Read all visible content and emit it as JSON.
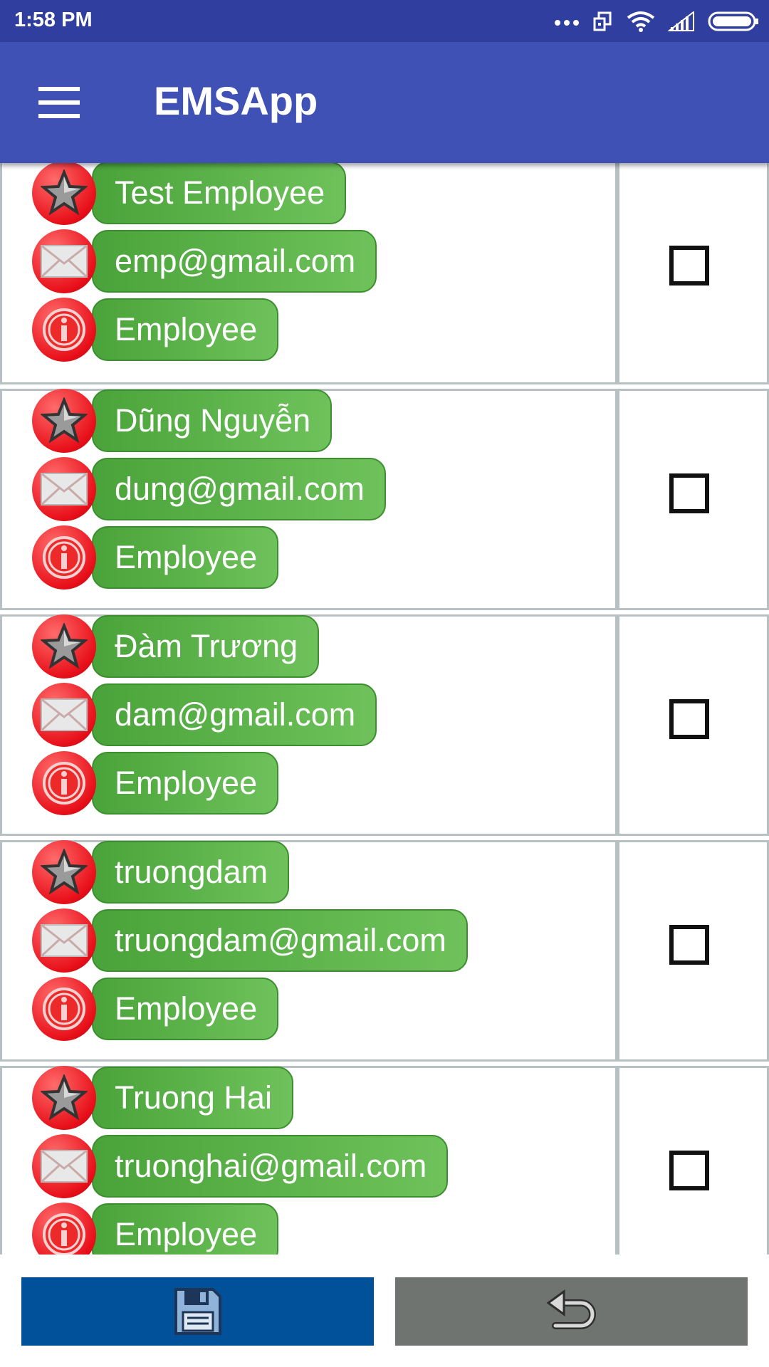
{
  "status_bar": {
    "time": "1:58 PM",
    "icons": [
      "more-dots-icon",
      "screen-rotate-icon",
      "wifi-icon",
      "signal-icon",
      "battery-icon"
    ]
  },
  "app_bar": {
    "title": "EMSApp",
    "menu_icon": "hamburger-menu-icon"
  },
  "colors": {
    "status_bar": "#303f9f",
    "app_bar": "#3f51b5",
    "pill_green": "#5cb34a",
    "icon_red": "#e8101a",
    "save_button": "#01509a",
    "undo_button": "#6f7470"
  },
  "employees": [
    {
      "name": "Test Employee",
      "email": "emp@gmail.com",
      "role": "Employee",
      "checked": false
    },
    {
      "name": "Dũng Nguyễn",
      "email": "dung@gmail.com",
      "role": "Employee",
      "checked": false
    },
    {
      "name": "Đàm Trương",
      "email": "dam@gmail.com",
      "role": "Employee",
      "checked": false
    },
    {
      "name": "truongdam",
      "email": "truongdam@gmail.com",
      "role": "Employee",
      "checked": false
    },
    {
      "name": "Truong Hai",
      "email": "truonghai@gmail.com",
      "role": "Employee",
      "checked": false
    }
  ],
  "row_icons": [
    "star-icon",
    "envelope-icon",
    "info-icon"
  ],
  "bottom_bar": {
    "save_icon": "floppy-disk-icon",
    "undo_icon": "undo-arrow-icon"
  }
}
